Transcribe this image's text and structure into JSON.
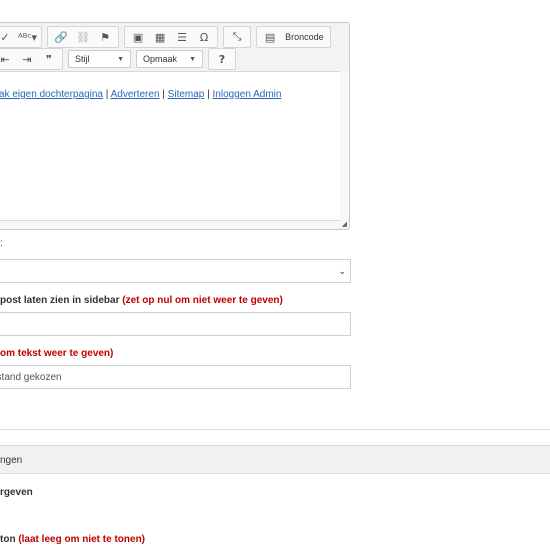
{
  "editor": {
    "toolbar_row1": {
      "group1": [
        "✓",
        "ᴬᴮᶜ▾"
      ],
      "group2": [
        "🔗",
        "⛓",
        "⚑"
      ],
      "group3": [
        "▣",
        "▦",
        "☰",
        "Ω"
      ],
      "maximize": "⤡",
      "source_icon": "▤",
      "source_label": "Broncode"
    },
    "toolbar_row2": {
      "list_group": [
        "⇤",
        "⇥",
        "❞"
      ],
      "style_combo": "Stijl",
      "format_combo": "Opmaak",
      "help": "?"
    },
    "content_links": {
      "link1": "ak eigen dochterpagina",
      "sep1": " | ",
      "link2": "Adverteren",
      "sep2": " | ",
      "link3": "Sitemap",
      "sep3": " | ",
      "link4": "Inloggen Admin"
    },
    "resize_glyph": "◢"
  },
  "form": {
    "label_colon": ":",
    "select_chevron": "⌄",
    "sidebar_label_main": "post laten zien in sidebar ",
    "sidebar_label_note": "(zet op nul om niet weer te geven)",
    "sidebar_value": "",
    "text_label_note": "om tekst weer te geven)",
    "file_value": "estand gekozen"
  },
  "section": {
    "title": "ngen",
    "label1": "rgeven",
    "label2_main": "ton ",
    "label2_note": "(laat leeg om niet te tonen)"
  }
}
